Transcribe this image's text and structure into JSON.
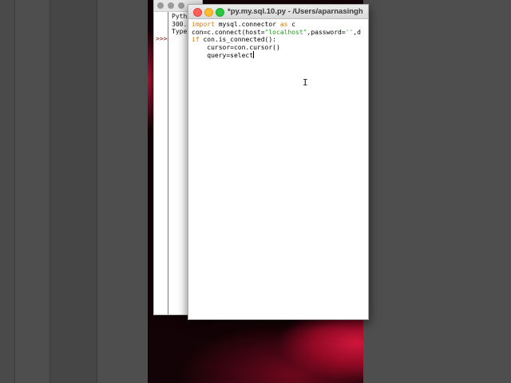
{
  "editor": {
    "title": "*py.my.sql.10.py - /Users/aparnasingh",
    "code_lines": [
      [
        {
          "t": "import",
          "c": "kw"
        },
        {
          "t": " mysql.connector ",
          "c": ""
        },
        {
          "t": "as",
          "c": "kw"
        },
        {
          "t": " c",
          "c": ""
        }
      ],
      [
        {
          "t": "con=c.connect(host=",
          "c": ""
        },
        {
          "t": "\"localhost\"",
          "c": "str"
        },
        {
          "t": ",password=",
          "c": ""
        },
        {
          "t": "''",
          "c": "str"
        },
        {
          "t": ",d",
          "c": ""
        }
      ],
      [
        {
          "t": "if",
          "c": "kw"
        },
        {
          "t": " con.is_connected():",
          "c": ""
        }
      ],
      [
        {
          "t": "    cursor=con.cursor()",
          "c": ""
        }
      ],
      [
        {
          "t": "    query=select",
          "c": ""
        }
      ]
    ]
  },
  "shell": {
    "lines": [
      "Pyth",
      "300.",
      "Type"
    ],
    "prompt": ">>>"
  }
}
